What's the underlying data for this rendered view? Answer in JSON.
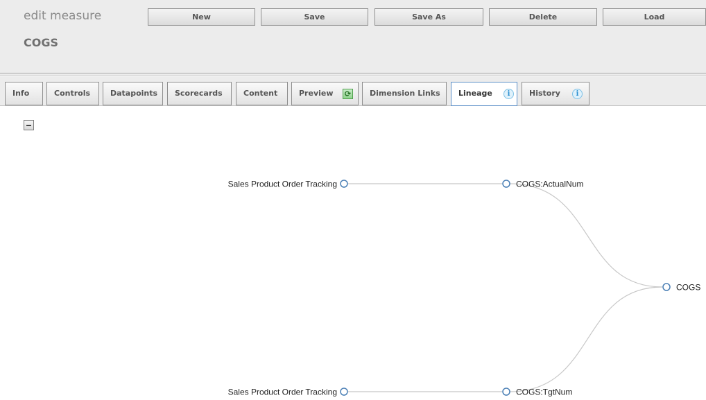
{
  "header": {
    "title": "edit measure",
    "subtitle": "COGS",
    "buttons": {
      "new": "New",
      "save": "Save",
      "save_as": "Save As",
      "delete": "Delete",
      "load": "Load"
    }
  },
  "tabs": {
    "info": "Info",
    "controls": "Controls",
    "datapoints": "Datapoints",
    "scorecards": "Scorecards",
    "content": "Content",
    "preview": "Preview",
    "dimension_links": "Dimension Links",
    "lineage": "Lineage",
    "history": "History",
    "active": "Lineage",
    "preview_icon": "refresh-icon",
    "lineage_icon": "info-icon",
    "history_icon": "info-icon",
    "info_glyph": "i",
    "refresh_glyph": "⟳"
  },
  "lineage": {
    "collapse_icon": "minus-icon",
    "sources": {
      "top": "Sales Product Order Tracking",
      "bottom": "Sales Product Order Tracking"
    },
    "fields": {
      "actual": "COGS:ActualNum",
      "target": "COGS:TgtNum"
    },
    "measure": "COGS",
    "colors": {
      "node_stroke": "#4a7fb5",
      "link": "#c8c8c8"
    }
  }
}
